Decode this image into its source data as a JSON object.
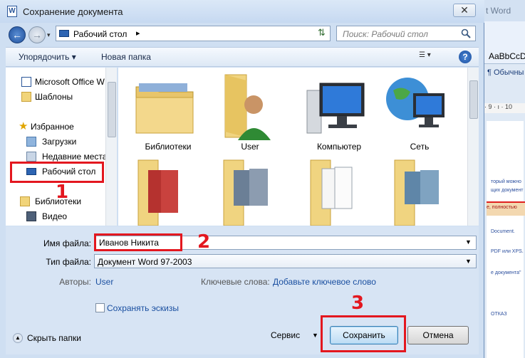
{
  "background_window": {
    "title": "t Word",
    "style_preview_1": "AaBbCcD",
    "style_preview_2": "¶ Обычны",
    "ruler": "· 9 · ı · 10",
    "snippets": [
      "торый можно",
      "щих документ",
      "Document.",
      "PDF или XPS.",
      "е документа\"",
      "ОТКАЗ"
    ],
    "highlight_text": "е, полностью"
  },
  "dialog": {
    "title": "Сохранение документа",
    "close_glyph": "✕"
  },
  "address_bar": {
    "location": "Рабочий стол",
    "chevron": "▸",
    "dropdown_glyph": "▾"
  },
  "search": {
    "placeholder": "Поиск: Рабочий стол"
  },
  "toolbar": {
    "organize_label": "Упорядочить ▾",
    "new_folder_label": "Новая папка",
    "views_glyph": "☰ ▾",
    "help_glyph": "?"
  },
  "nav_pane": {
    "items": [
      {
        "label": "Microsoft Office W",
        "icon": "word-document-icon"
      },
      {
        "label": "Шаблоны",
        "icon": "folder-icon"
      },
      {
        "label": "Избранное",
        "icon": "star-icon"
      },
      {
        "label": "Загрузки",
        "icon": "downloads-icon"
      },
      {
        "label": "Недавние места",
        "icon": "recent-places-icon"
      },
      {
        "label": "Рабочий стол",
        "icon": "desktop-icon"
      },
      {
        "label": "Библиотеки",
        "icon": "libraries-icon"
      },
      {
        "label": "Видео",
        "icon": "video-icon"
      }
    ]
  },
  "files": [
    {
      "label": "Библиотеки",
      "icon": "libraries-folder-icon"
    },
    {
      "label": "User",
      "icon": "user-folder-icon"
    },
    {
      "label": "Компьютер",
      "icon": "computer-icon"
    },
    {
      "label": "Сеть",
      "icon": "network-icon"
    },
    {
      "label": "",
      "icon": "presentation-folder-icon"
    },
    {
      "label": "",
      "icon": "photos-folder-icon"
    },
    {
      "label": "",
      "icon": "documents-folder-icon"
    },
    {
      "label": "",
      "icon": "pictures-folder-icon"
    }
  ],
  "form": {
    "filename_label": "Имя файла:",
    "filename_value": "Иванов Никита",
    "filetype_label": "Тип файла:",
    "filetype_value": "Документ Word 97-2003",
    "authors_label": "Авторы:",
    "authors_value": "User",
    "keywords_label": "Ключевые слова:",
    "keywords_value": "Добавьте ключевое слово",
    "save_thumbnails_label": "Сохранять эскизы",
    "hide_folders_label": "Скрыть папки",
    "tools_label": "Сервис",
    "tools_glyph": "▼",
    "save_label": "Сохранить",
    "cancel_label": "Отмена"
  },
  "annotations": {
    "step1": "1",
    "step2": "2",
    "step3": "3",
    "color": "#e3171f"
  }
}
